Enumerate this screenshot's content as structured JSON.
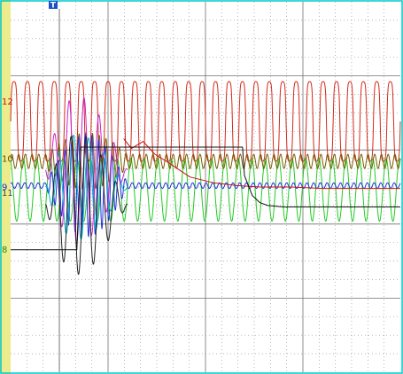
{
  "colors": {
    "background": "#ffffff",
    "left_strip": "#ecec8c",
    "frame": "#00c8c8",
    "grid_dots": "#9a9a9a",
    "grid_major": "#707070",
    "trigger_bg": "#1d4fc9"
  },
  "trigger_marker": {
    "label": "T",
    "icon": "trigger-flag-icon"
  },
  "chart_data": {
    "type": "line",
    "title": "",
    "xlabel": "",
    "ylabel": "",
    "grid": true,
    "legend": "none",
    "time_range": [
      0,
      1
    ],
    "trigger_time": 0.125,
    "channel_labels": [
      {
        "text": "12",
        "color": "#cc1111",
        "y": 12
      },
      {
        "text": "10",
        "color": "#6b4a00",
        "y": 10
      },
      {
        "text": "9",
        "color": "#1f2fd8",
        "y": 9
      },
      {
        "text": "11",
        "color": "#444444",
        "y": 8.8
      },
      {
        "text": "8",
        "color": "#228822",
        "y": 6.8
      }
    ],
    "series": [
      {
        "id": "ch12",
        "color": "#d42a1a",
        "kind": "sine",
        "center": 11.3,
        "amp": 1.4,
        "cycles": 29,
        "phase": 0.0,
        "burst_gain": 1.0,
        "square": true
      },
      {
        "id": "green",
        "color": "#22cc22",
        "kind": "sine",
        "center": 8.9,
        "amp": 1.1,
        "cycles": 29,
        "phase": 1.9,
        "burst_gain": 1.0,
        "square": false
      },
      {
        "id": "ch10",
        "color": "#7a5a00",
        "kind": "sine",
        "center": 9.9,
        "amp": 0.25,
        "cycles": 58,
        "phase": 0.4,
        "burst_gain": 4.0,
        "square": false
      },
      {
        "id": "ch9",
        "color": "#2233dd",
        "kind": "sine",
        "center": 9.05,
        "amp": 0.1,
        "cycles": 58,
        "phase": 1.0,
        "burst_gain": 18.0,
        "square": false
      },
      {
        "id": "cyan",
        "color": "#00b8d0",
        "kind": "burst",
        "center": 9.0,
        "amp": 3.0,
        "cycles": 26,
        "phase": 0.3
      },
      {
        "id": "magenta",
        "color": "#cc22cc",
        "kind": "burst",
        "center": 9.6,
        "amp": 4.2,
        "cycles": 26,
        "phase": 2.2
      },
      {
        "id": "black-burst",
        "color": "#222222",
        "kind": "burst",
        "center": 8.4,
        "amp": 4.0,
        "cycles": 26,
        "phase": 1.4
      },
      {
        "id": "red-env",
        "color": "#cc1111",
        "kind": "points",
        "t": [
          0.29,
          0.31,
          0.34,
          0.37,
          0.4,
          0.46,
          0.52,
          0.58,
          0.64,
          0.72,
          0.8,
          0.9,
          1.0
        ],
        "y": [
          10.7,
          10.35,
          10.6,
          10.15,
          9.9,
          9.35,
          9.15,
          9.05,
          9.0,
          9.0,
          8.95,
          8.95,
          8.95
        ]
      },
      {
        "id": "ch8",
        "color": "#111111",
        "kind": "points",
        "t": [
          0.0,
          0.17,
          0.18,
          0.3,
          0.31,
          0.595,
          0.6,
          0.62,
          0.64,
          0.66,
          0.7,
          1.0
        ],
        "y": [
          6.8,
          6.8,
          10.4,
          10.4,
          10.4,
          10.4,
          9.4,
          8.7,
          8.45,
          8.35,
          8.3,
          8.3
        ]
      }
    ]
  }
}
